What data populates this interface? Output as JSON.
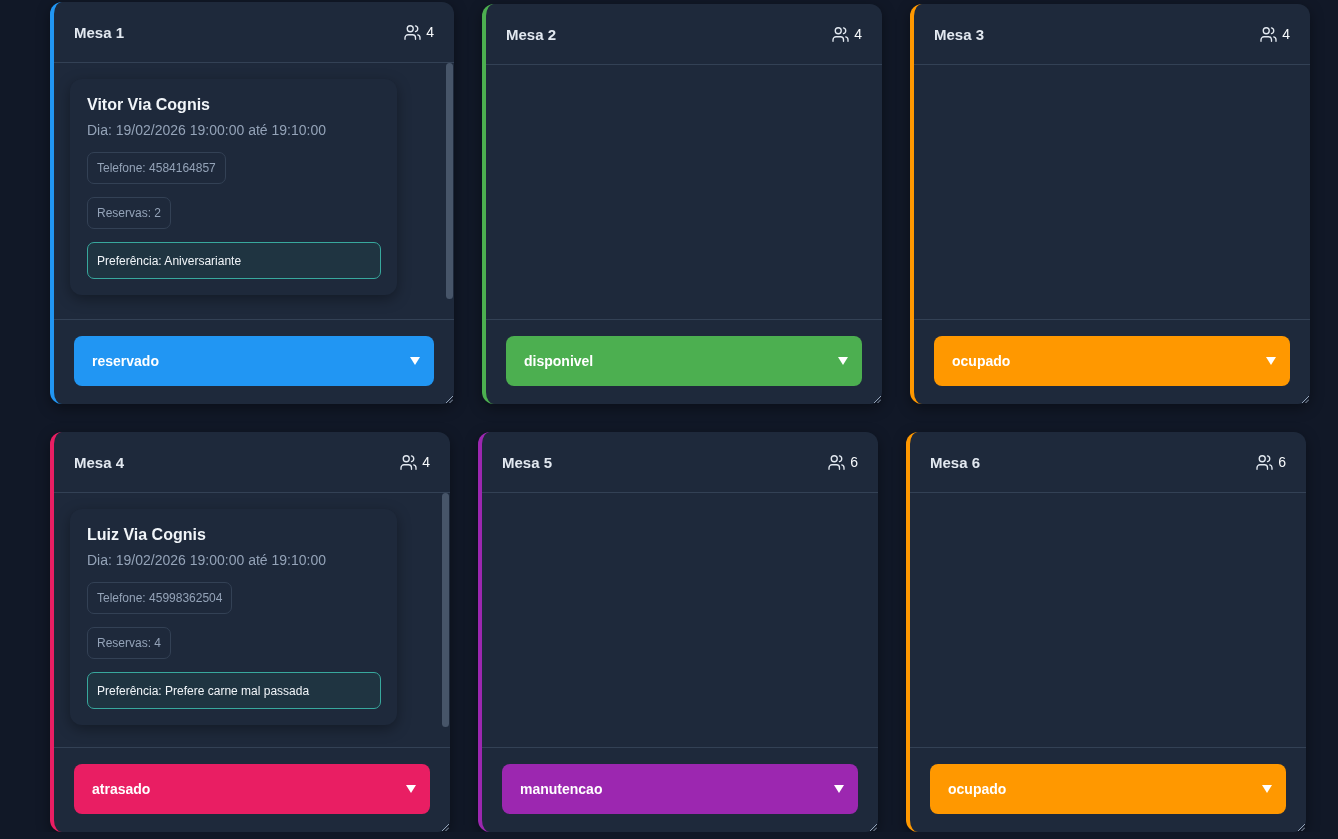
{
  "tables": [
    {
      "name": "Mesa 1",
      "seats": "4",
      "status": "reservado",
      "color": "#2196f3",
      "reservations": [
        {
          "guest": "Vitor Via Cognis",
          "schedule": "Dia: 19/02/2026 19:00:00 até 19:10:00",
          "phone": "Telefone: 4584164857",
          "bookings": "Reservas: 2",
          "preference": "Preferência: Aniversariante"
        }
      ]
    },
    {
      "name": "Mesa 2",
      "seats": "4",
      "status": "disponivel",
      "color": "#4caf50"
    },
    {
      "name": "Mesa 3",
      "seats": "4",
      "status": "ocupado",
      "color": "#ff9800"
    },
    {
      "name": "Mesa 4",
      "seats": "4",
      "status": "atrasado",
      "color": "#e91e63",
      "reservations": [
        {
          "guest": "Luiz Via Cognis",
          "schedule": "Dia: 19/02/2026 19:00:00 até 19:10:00",
          "phone": "Telefone: 45998362504",
          "bookings": "Reservas: 4",
          "preference": "Preferência: Prefere carne mal passada"
        }
      ]
    },
    {
      "name": "Mesa 5",
      "seats": "6",
      "status": "manutencao",
      "color": "#9c27b0"
    },
    {
      "name": "Mesa 6",
      "seats": "6",
      "status": "ocupado",
      "color": "#ff9800"
    }
  ]
}
